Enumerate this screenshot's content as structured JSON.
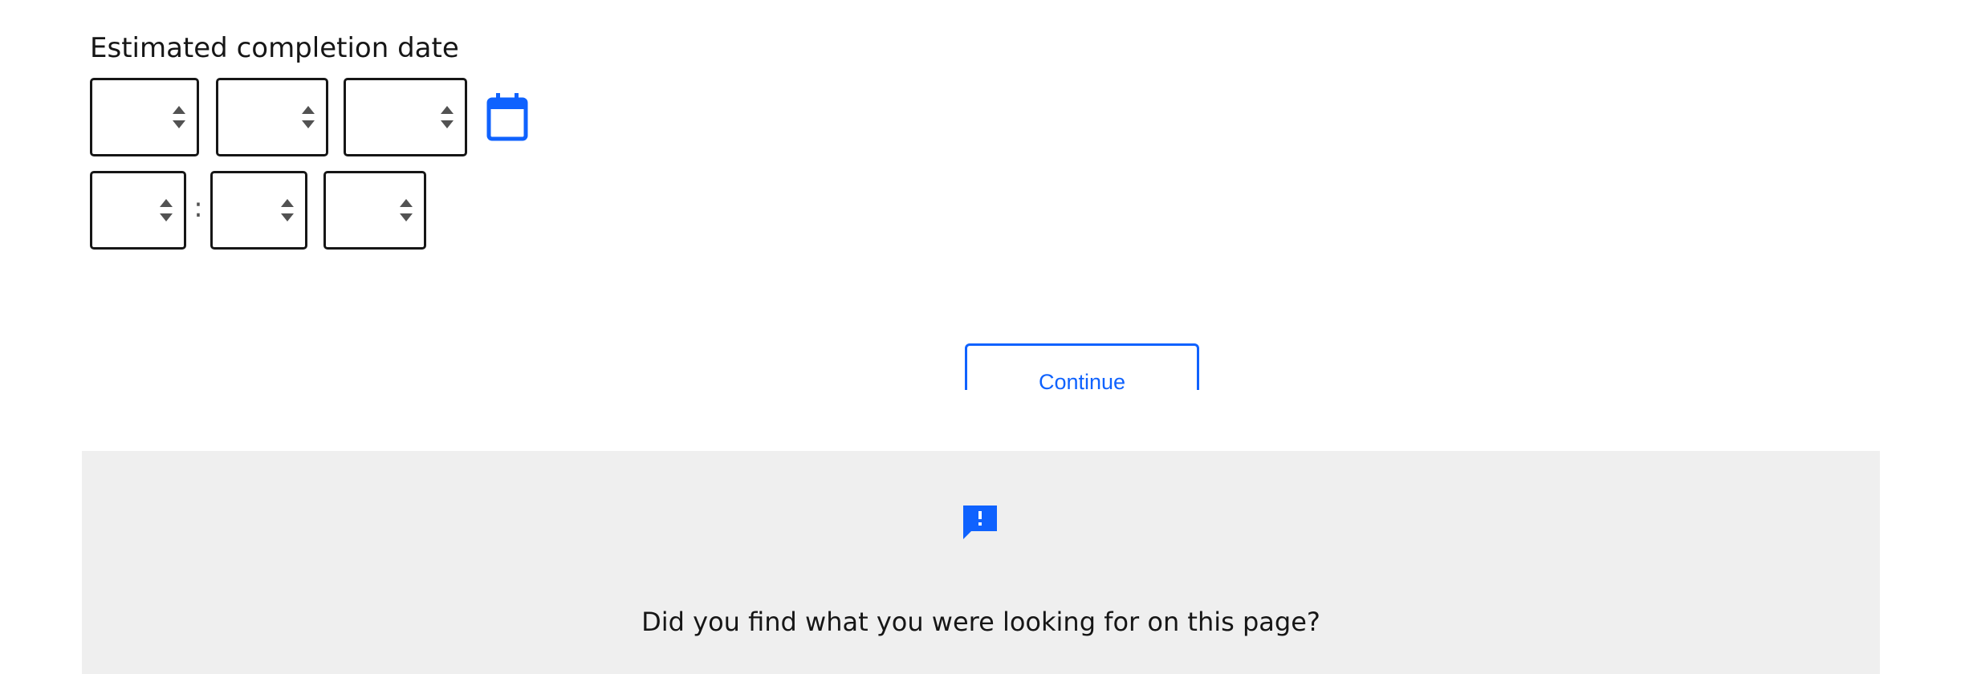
{
  "form": {
    "label": "Estimated completion date",
    "date_fields": [
      {
        "name": "month",
        "value": ""
      },
      {
        "name": "day",
        "value": ""
      },
      {
        "name": "year",
        "value": ""
      }
    ],
    "time_fields": [
      {
        "name": "hour",
        "value": ""
      },
      {
        "name": "minute",
        "value": ""
      },
      {
        "name": "ampm",
        "value": ""
      }
    ],
    "time_separator": ":",
    "calendar_icon": "calendar-icon"
  },
  "actions": {
    "continue_label": "Continue"
  },
  "feedback": {
    "icon": "feedback-chat-exclamation-icon",
    "question": "Did you find what you were looking for on this page?"
  },
  "colors": {
    "accent": "#0f62fe",
    "text": "#161616",
    "feedback_bg": "#efefef"
  }
}
